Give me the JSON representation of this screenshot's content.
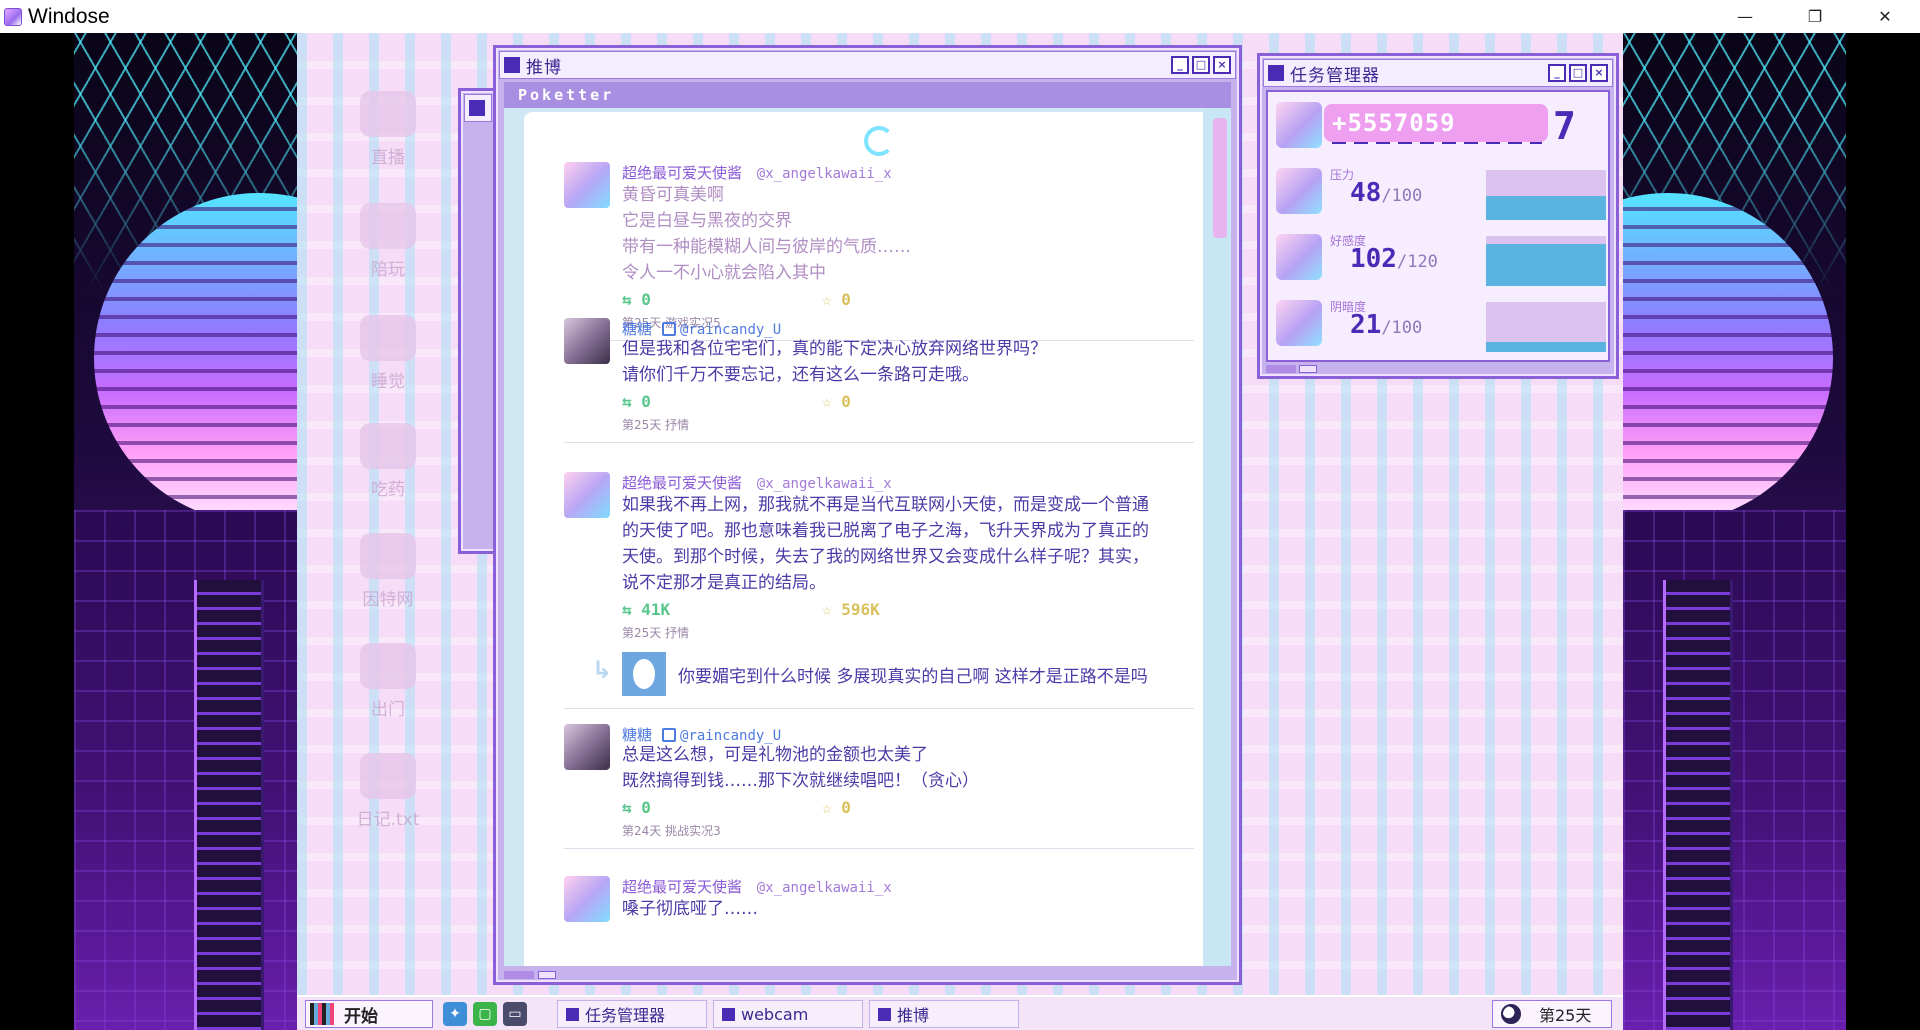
{
  "os_window": {
    "title": "Windose",
    "controls": {
      "minimize": "—",
      "restore": "❐",
      "close": "✕"
    }
  },
  "desktop_icons": [
    {
      "label": "直播",
      "icon": "stream-icon"
    },
    {
      "label": "陪玩",
      "icon": "paw-icon"
    },
    {
      "label": "睡觉",
      "icon": "sleep-icon"
    },
    {
      "label": "吃药",
      "icon": "pill-icon"
    },
    {
      "label": "因特网",
      "icon": "internet-icon"
    },
    {
      "label": "出门",
      "icon": "go-out-icon"
    },
    {
      "label": "日记.txt",
      "icon": "diary-icon"
    }
  ],
  "poketter_window": {
    "title": "推博",
    "header": "Poketter",
    "posts": [
      {
        "name": "超绝最可爱天使酱",
        "handle": "@x_angelkawaii_x",
        "lines": [
          "黄昏可真美啊",
          "它是白昼与黑夜的交界",
          "带有一种能模糊人间与彼岸的气质……",
          "令人一不小心就会陷入其中"
        ],
        "retweets": "0",
        "likes": "0",
        "meta": "第25天 游戏实况5"
      },
      {
        "name": "糖糖",
        "handle": "@raincandy_U",
        "lines": [
          "但是我和各位宅宅们，真的能下定决心放弃网络世界吗？",
          "请你们千万不要忘记，还有这么一条路可走哦。"
        ],
        "retweets": "0",
        "likes": "0",
        "meta": "第25天 抒情"
      },
      {
        "name": "超绝最可爱天使酱",
        "handle": "@x_angelkawaii_x",
        "lines": [
          "如果我不再上网，那我就不再是当代互联网小天使，而是变成一个普通",
          "的天使了吧。那也意味着我已脱离了电子之海，飞升天界成为了真正的",
          "天使。到那个时候，失去了我的网络世界又会变成什么样子呢？其实，",
          "说不定那才是真正的结局。"
        ],
        "retweets": "41K",
        "likes": "596K",
        "meta": "第25天 抒情",
        "reply": "你要媚宅到什么时候 多展现真实的自己啊 这样才是正路不是吗"
      },
      {
        "name": "糖糖",
        "handle": "@raincandy_U",
        "lines": [
          "总是这么想，可是礼物池的金额也太美了",
          "既然搞得到钱……那下次就继续唱吧！（贪心）"
        ],
        "retweets": "0",
        "likes": "0",
        "meta": "第24天 挑战实况3"
      },
      {
        "name": "超绝最可爱天使酱",
        "handle": "@x_angelkawaii_x",
        "lines": [
          "嗓子彻底哑了……"
        ]
      }
    ]
  },
  "taskmgr_window": {
    "title": "任务管理器",
    "followers": "+5557059",
    "followers_tail": "7",
    "stats": [
      {
        "label": "压力",
        "value": "48",
        "max": "/100",
        "fill": 0.48,
        "color": "#5bb4e0"
      },
      {
        "label": "好感度",
        "value": "102",
        "max": "/120",
        "fill": 0.85,
        "color": "#5bb4e0"
      },
      {
        "label": "阴暗度",
        "value": "21",
        "max": "/100",
        "fill": 0.21,
        "color": "#5bb4e0"
      }
    ]
  },
  "taskbar": {
    "start_label": "开始",
    "quick_icons": [
      "poketter-bird-icon",
      "chat-icon",
      "monitor-icon"
    ],
    "tasks": [
      "任务管理器",
      "webcam",
      "推博"
    ],
    "day_label": "第25天"
  },
  "colors": {
    "accent": "#4a2bb6",
    "window_frame": "#8a60d8",
    "desktop_bg": "#f6dcf6",
    "bar_fill": "#5bb4e0"
  }
}
